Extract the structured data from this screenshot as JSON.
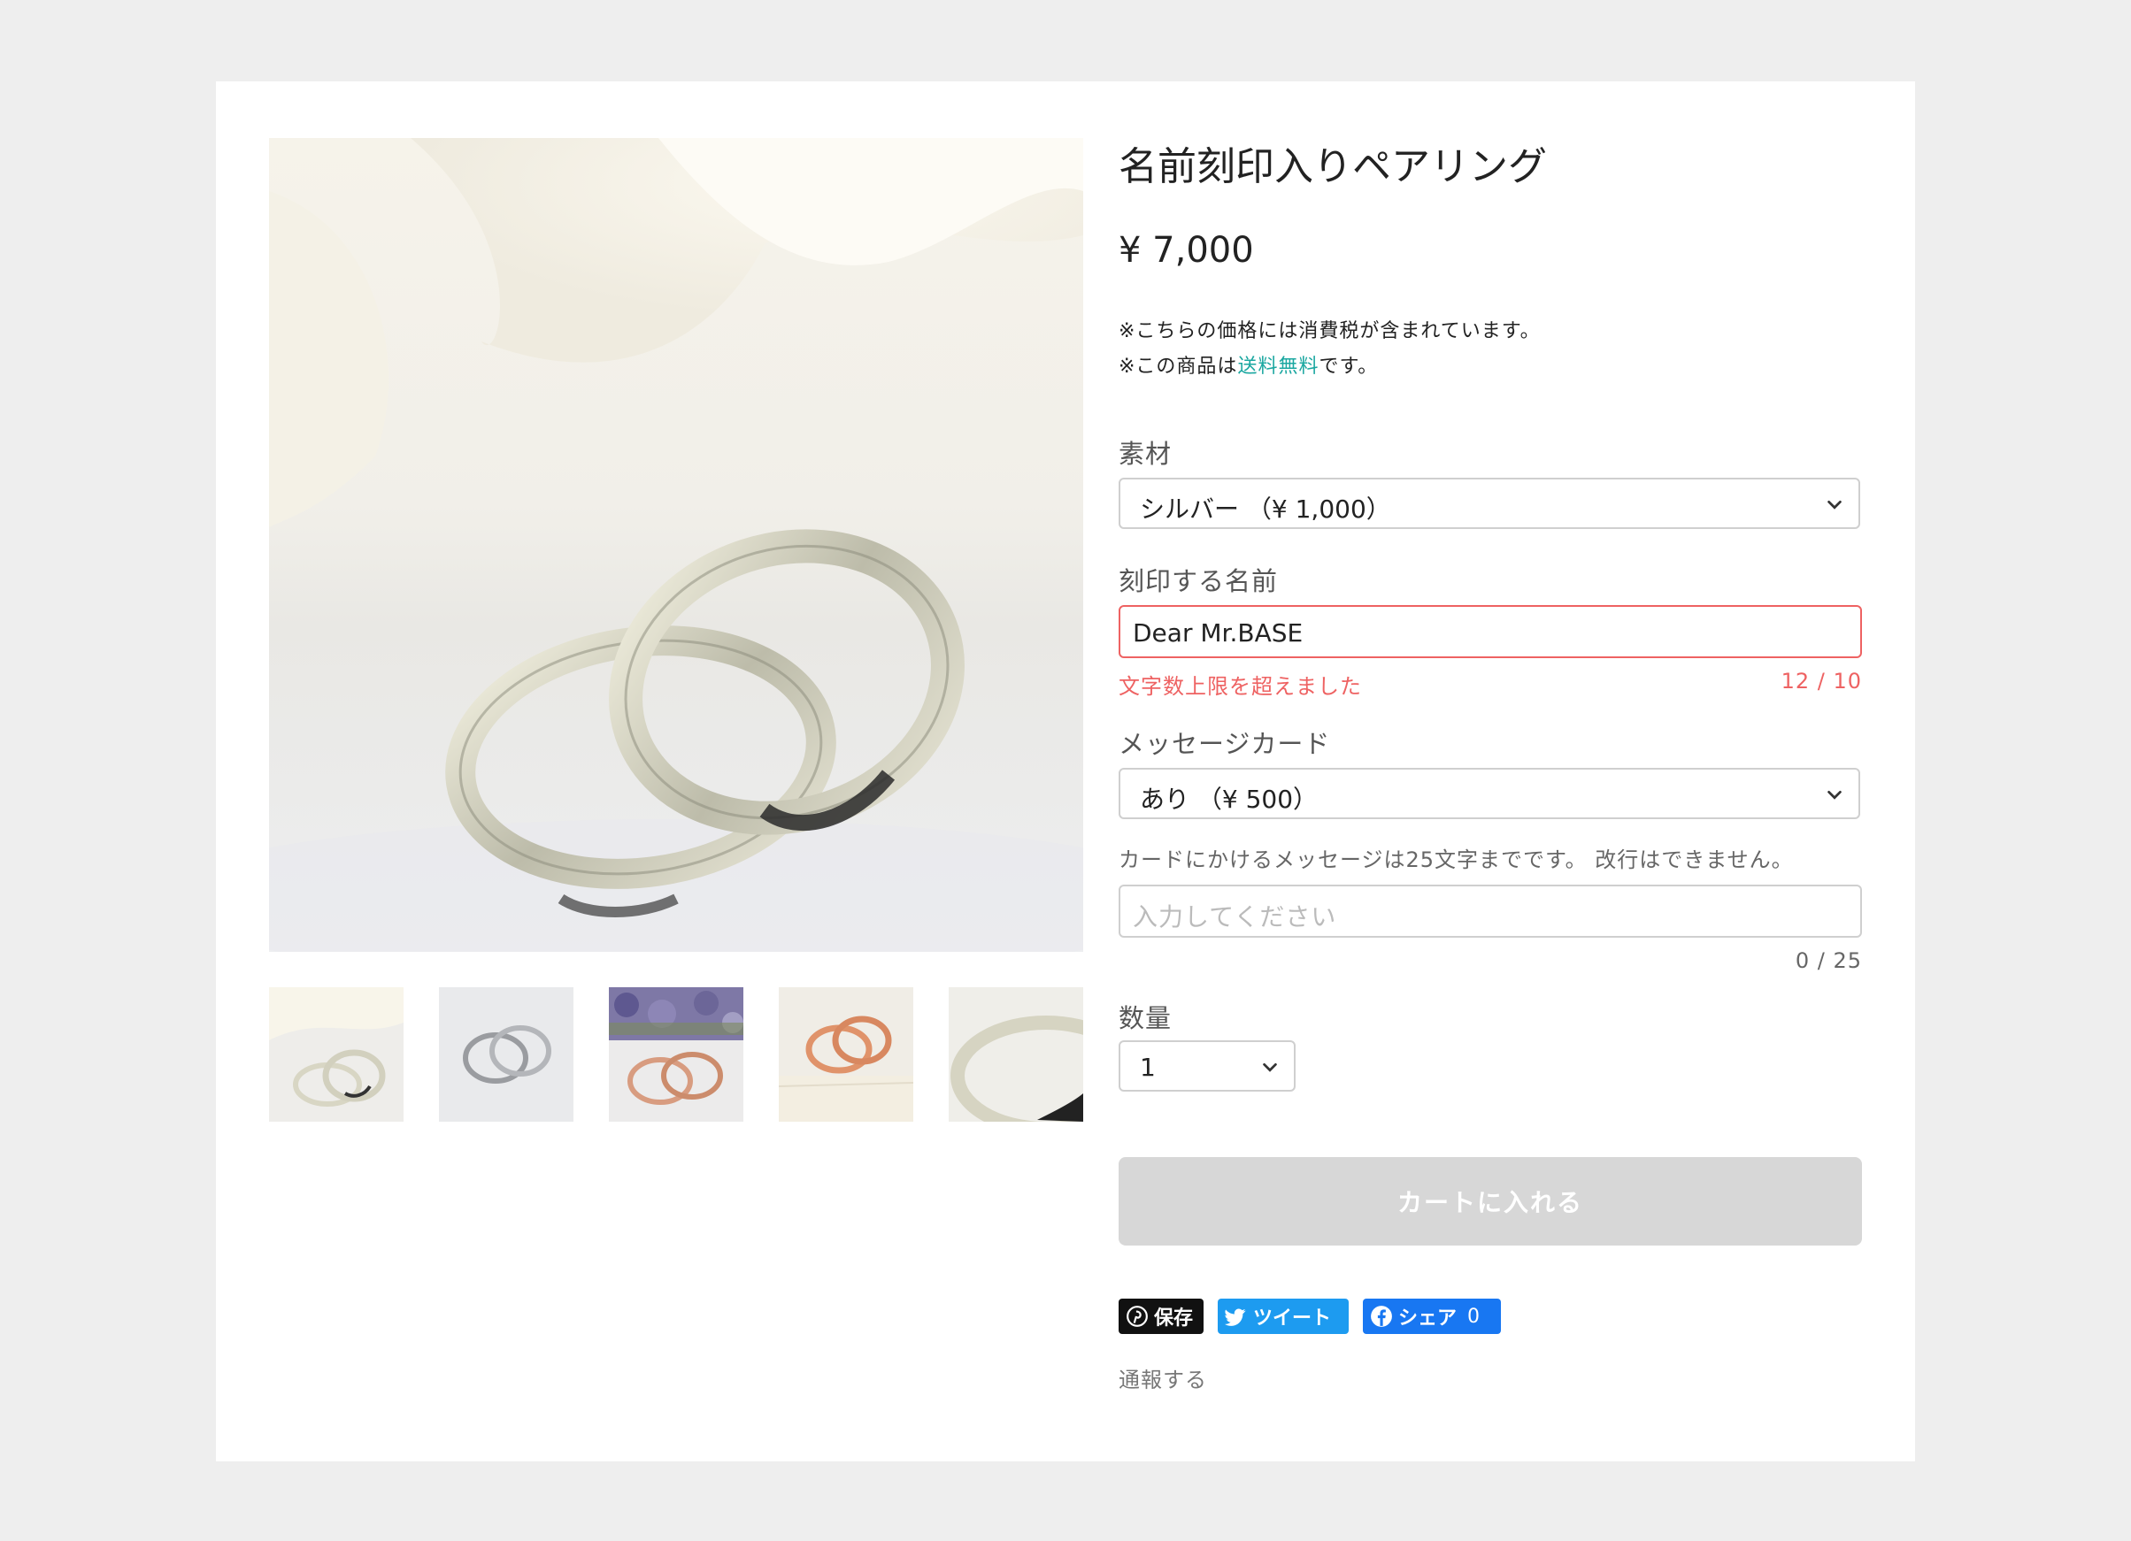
{
  "product": {
    "title": "名前刻印入りペアリング",
    "price": "¥ 7,000",
    "tax_note": "※こちらの価格には消費税が含まれています。",
    "shipping_prefix": "※この商品は",
    "shipping_highlight": "送料無料",
    "shipping_suffix": "です。"
  },
  "options": {
    "material": {
      "label": "素材",
      "selected": "シルバー （¥ 1,000）"
    },
    "engraving": {
      "label": "刻印する名前",
      "value": "Dear Mr.BASE",
      "error": "文字数上限を超えました",
      "counter": "12 / 10"
    },
    "message_card": {
      "label": "メッセージカード",
      "selected": "あり （¥ 500）"
    },
    "card_message": {
      "hint": "カードにかけるメッセージは25文字までです。 改行はできません。",
      "placeholder": "入力してください",
      "counter": "0 / 25"
    },
    "quantity": {
      "label": "数量",
      "selected": "1"
    }
  },
  "cart_button": "カートに入れる",
  "share": {
    "pinterest": "保存",
    "twitter": "ツイート",
    "facebook": "シェア",
    "facebook_count": "0"
  },
  "report_link": "通報する",
  "thumbnails": [
    {
      "name": "silver-rings-on-white"
    },
    {
      "name": "silver-rings-plain"
    },
    {
      "name": "rose-gold-rings-lavender"
    },
    {
      "name": "rose-gold-rings-book"
    },
    {
      "name": "silver-ring-closeup"
    }
  ],
  "colors": {
    "accent_free_shipping": "#1aa7a0",
    "error": "#ee6262",
    "cart_disabled": "#d7d7d7",
    "twitter": "#1d9bf0",
    "facebook": "#1877f2",
    "pinterest": "#111111"
  }
}
